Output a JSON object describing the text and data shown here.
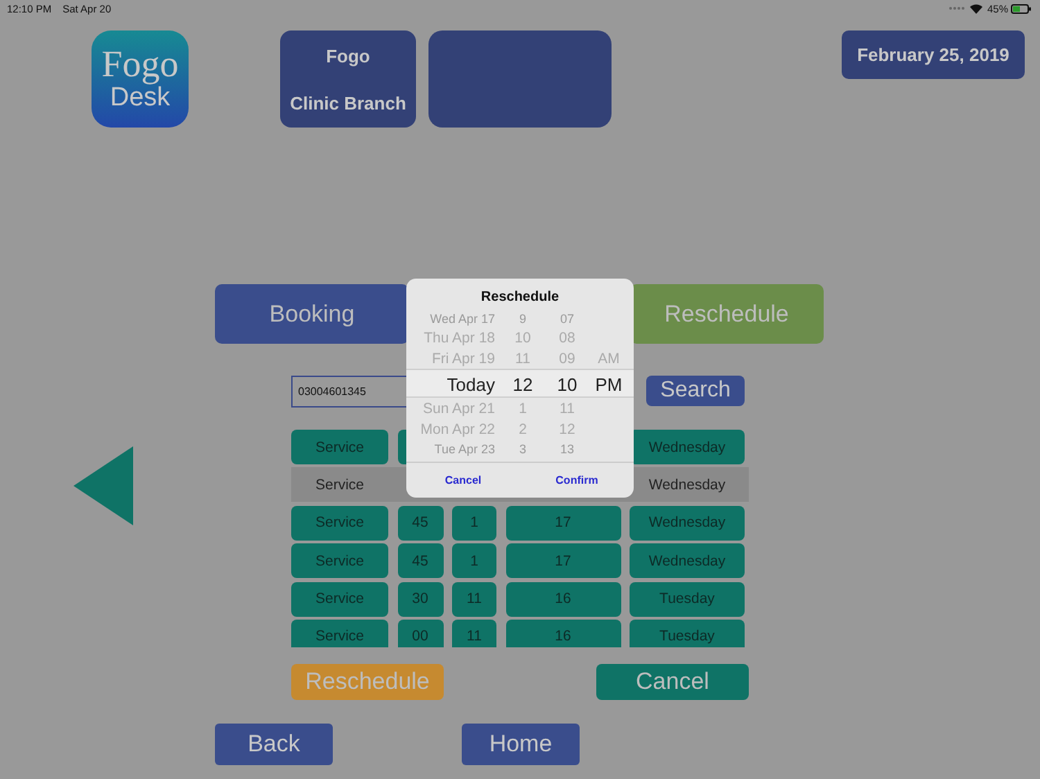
{
  "status_bar": {
    "time": "12:10 PM",
    "date": "Sat Apr 20",
    "battery": "45%"
  },
  "header": {
    "logo": {
      "line_1": "Fogo",
      "line_2": "Desk"
    },
    "branch": {
      "line_1": "Fogo",
      "line_2": "Clinic Branch"
    },
    "date": "February 25, 2019"
  },
  "tabs": [
    {
      "label": "Booking",
      "selected": false
    },
    {
      "label": "Reschedule",
      "selected": true
    }
  ],
  "search": {
    "value": "03004601345",
    "button": "Search"
  },
  "table": {
    "rows": [
      {
        "selected": false,
        "column_1": "Service",
        "column_5": "Wednesday"
      },
      {
        "selected": true,
        "column_1": "Service",
        "column_5": "Wednesday"
      },
      {
        "selected": false,
        "column_1": "Service",
        "column_2": "45",
        "column_3": "1",
        "column_4": "17",
        "column_5": "Wednesday"
      },
      {
        "selected": false,
        "column_1": "Service",
        "column_2": "45",
        "column_3": "1",
        "column_4": "17",
        "column_5": "Wednesday"
      },
      {
        "selected": false,
        "column_1": "Service",
        "column_2": "30",
        "column_3": "11",
        "column_4": "16",
        "column_5": "Tuesday"
      },
      {
        "selected": false,
        "column_1": "Service",
        "column_2": "00",
        "column_3": "11",
        "column_4": "16",
        "column_5": "Tuesday"
      }
    ]
  },
  "actions": [
    {
      "label": "Reschedule",
      "kind": "reschedule"
    },
    {
      "label": "Cancel",
      "kind": "cancel"
    }
  ],
  "nav": [
    "Back",
    "Home"
  ],
  "dialog": {
    "title": "Reschedule",
    "columns": [
      {
        "kind": "day",
        "items": [
          {
            "label": "Wed Apr 17",
            "selected": false
          },
          {
            "label": "Thu Apr 18",
            "selected": false
          },
          {
            "label": "Fri Apr 19",
            "selected": false
          },
          {
            "label": "Today",
            "selected": true
          },
          {
            "label": "Sun Apr 21",
            "selected": false
          },
          {
            "label": "Mon Apr 22",
            "selected": false
          },
          {
            "label": "Tue Apr 23",
            "selected": false
          }
        ]
      },
      {
        "kind": "hour",
        "items": [
          {
            "label": "9",
            "selected": false
          },
          {
            "label": "10",
            "selected": false
          },
          {
            "label": "11",
            "selected": false
          },
          {
            "label": "12",
            "selected": true
          },
          {
            "label": "1",
            "selected": false
          },
          {
            "label": "2",
            "selected": false
          },
          {
            "label": "3",
            "selected": false
          }
        ]
      },
      {
        "kind": "minute",
        "items": [
          {
            "label": "07",
            "selected": false
          },
          {
            "label": "08",
            "selected": false
          },
          {
            "label": "09",
            "selected": false
          },
          {
            "label": "10",
            "selected": true
          },
          {
            "label": "11",
            "selected": false
          },
          {
            "label": "12",
            "selected": false
          },
          {
            "label": "13",
            "selected": false
          }
        ]
      },
      {
        "kind": "meridiem",
        "items": [
          {
            "label": "AM",
            "selected": false
          },
          {
            "label": "PM",
            "selected": true
          }
        ]
      }
    ],
    "buttons": [
      "Cancel",
      "Confirm"
    ]
  }
}
